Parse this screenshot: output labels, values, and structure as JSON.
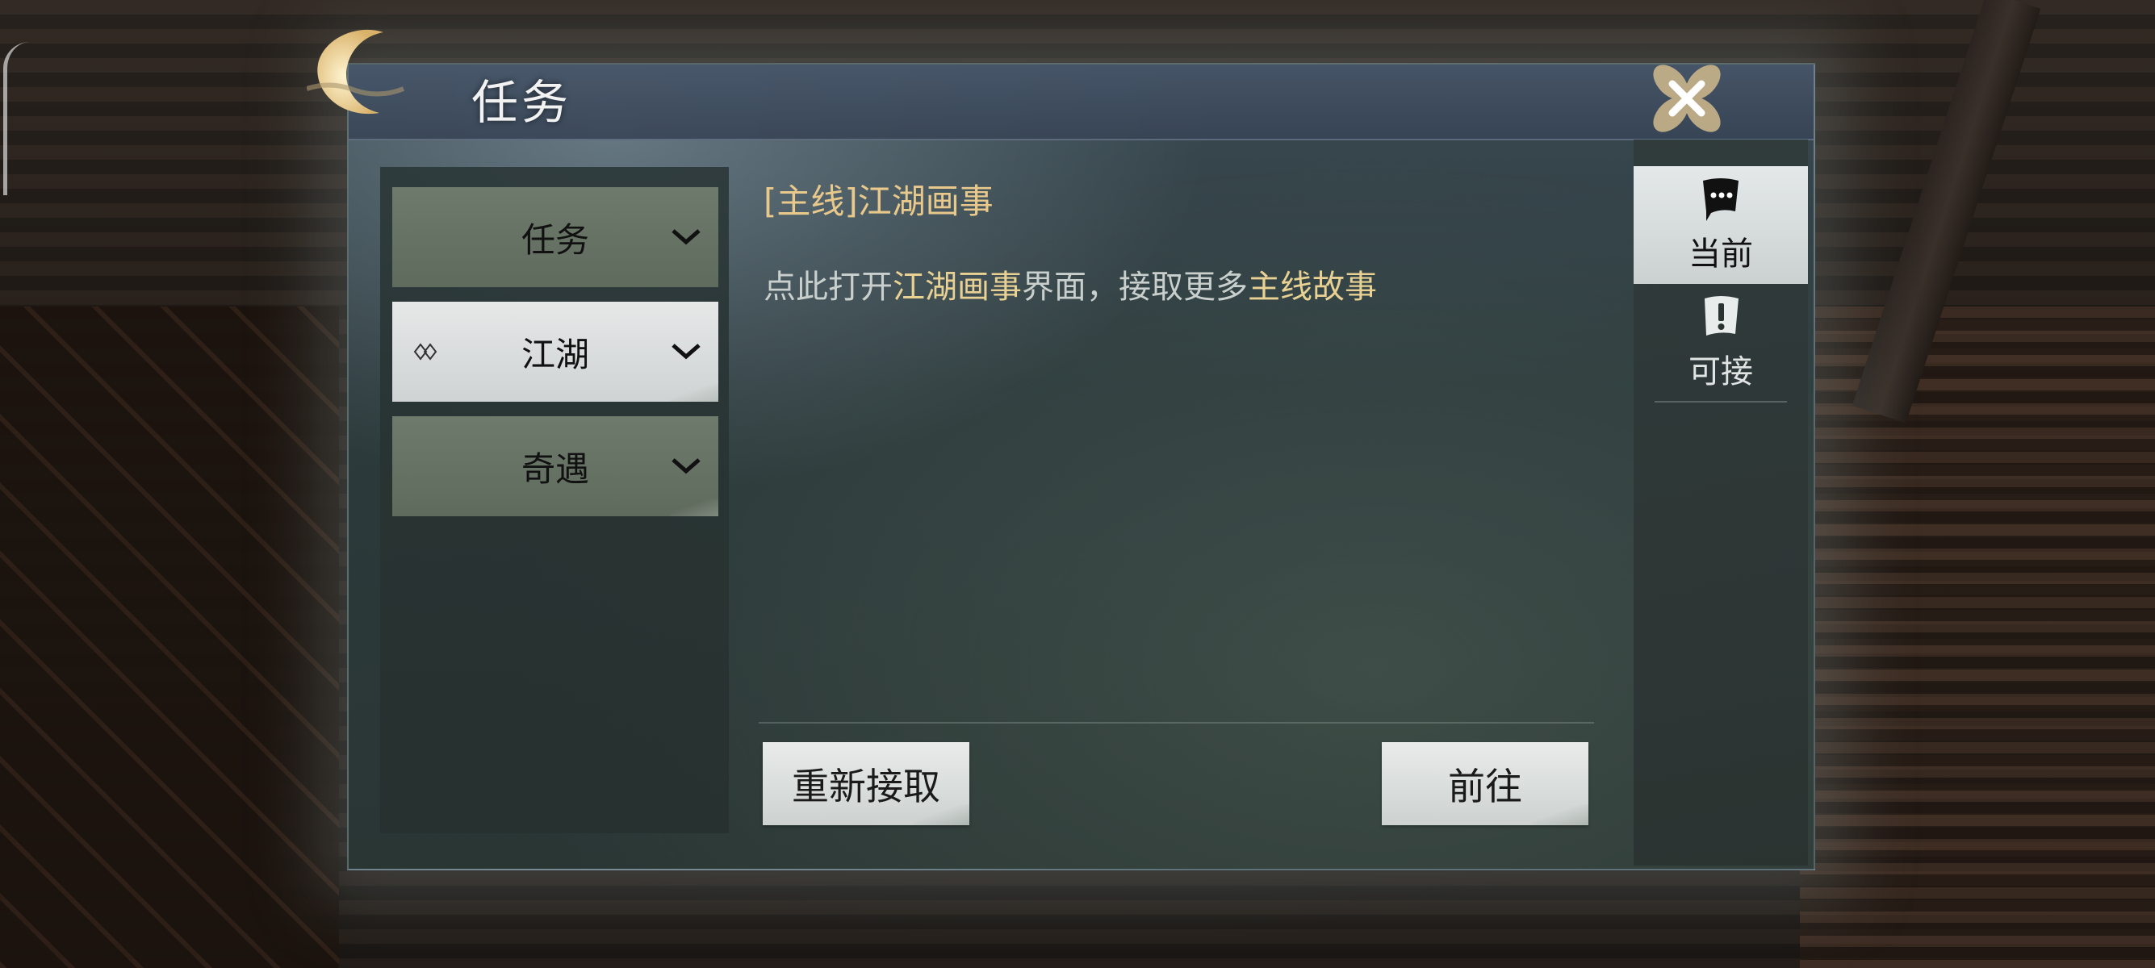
{
  "dialog": {
    "title": "任务",
    "close_icon": "close-x-icon"
  },
  "categories": [
    {
      "label": "任务",
      "state": "collapsed",
      "selected": false
    },
    {
      "label": "江湖",
      "state": "collapsed",
      "selected": true
    },
    {
      "label": "奇遇",
      "state": "collapsed",
      "selected": false
    }
  ],
  "quest": {
    "title": "[主线]江湖画事",
    "desc_parts": {
      "p1": "点此打开",
      "p2": "江湖画事",
      "p3": "界面，接取更多",
      "p4": "主线故事"
    }
  },
  "buttons": {
    "reaccept": "重新接取",
    "goto": "前往"
  },
  "tabs": [
    {
      "label": "当前",
      "icon": "scroll-chat-icon",
      "active": true
    },
    {
      "label": "可接",
      "icon": "scroll-exclaim-icon",
      "active": false
    }
  ],
  "colors": {
    "quest_title": "#e9c98b",
    "highlight": "#e8d193",
    "active_bg": "#e6e8e8",
    "category_bg": "#6e7a6c"
  }
}
